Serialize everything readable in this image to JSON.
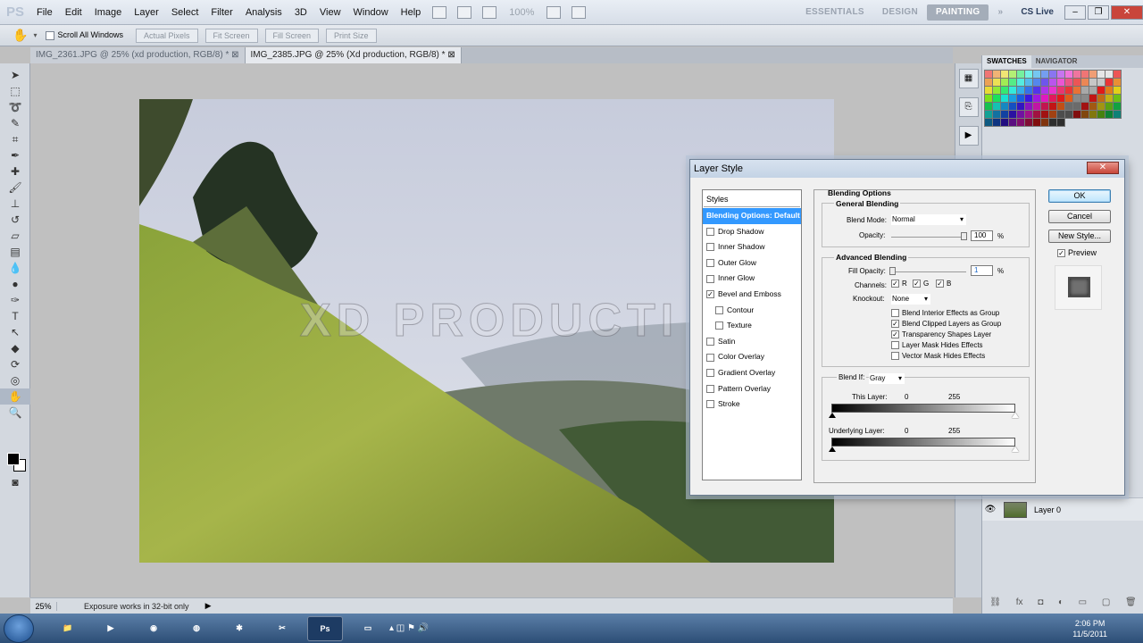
{
  "app": {
    "logo": "PS"
  },
  "menu": {
    "items": [
      "File",
      "Edit",
      "Image",
      "Layer",
      "Select",
      "Filter",
      "Analysis",
      "3D",
      "View",
      "Window",
      "Help"
    ]
  },
  "appbar": {
    "zoom": "100%"
  },
  "workspaces": {
    "items": [
      "ESSENTIALS",
      "DESIGN",
      "PAINTING"
    ],
    "active": "PAINTING",
    "more": "»"
  },
  "cslive": "CS Live",
  "options_bar": {
    "scroll_all": "Scroll All Windows",
    "buttons": [
      "Actual Pixels",
      "Fit Screen",
      "Fill Screen",
      "Print Size"
    ]
  },
  "doc_tabs": [
    {
      "label": "IMG_2361.JPG @ 25% (xd production, RGB/8) *"
    },
    {
      "label": "IMG_2385.JPG @ 25% (Xd production, RGB/8) *",
      "active": true
    }
  ],
  "canvas": {
    "watermark": "XD PRODUCTI"
  },
  "status": {
    "zoom": "25%",
    "text": "Exposure works in 32-bit only"
  },
  "right_panel": {
    "tabs": [
      "SWATCHES",
      "NAVIGATOR"
    ],
    "layer_name": "Layer 0"
  },
  "dialog": {
    "title": "Layer Style",
    "styles_header": "Styles",
    "styles": [
      {
        "label": "Blending Options: Default",
        "selected": true
      },
      {
        "label": "Drop Shadow",
        "checked": false
      },
      {
        "label": "Inner Shadow",
        "checked": false
      },
      {
        "label": "Outer Glow",
        "checked": false
      },
      {
        "label": "Inner Glow",
        "checked": false
      },
      {
        "label": "Bevel and Emboss",
        "checked": true
      },
      {
        "label": "Contour",
        "checked": false,
        "indent": true
      },
      {
        "label": "Texture",
        "checked": false,
        "indent": true
      },
      {
        "label": "Satin",
        "checked": false
      },
      {
        "label": "Color Overlay",
        "checked": false
      },
      {
        "label": "Gradient Overlay",
        "checked": false
      },
      {
        "label": "Pattern Overlay",
        "checked": false
      },
      {
        "label": "Stroke",
        "checked": false
      }
    ],
    "blending_options": "Blending Options",
    "general": {
      "title": "General Blending",
      "blend_mode_label": "Blend Mode:",
      "blend_mode": "Normal",
      "opacity_label": "Opacity:",
      "opacity": "100",
      "percent": "%"
    },
    "advanced": {
      "title": "Advanced Blending",
      "fill_opacity_label": "Fill Opacity:",
      "fill_opacity": "1",
      "percent": "%",
      "channels_label": "Channels:",
      "channels": [
        "R",
        "G",
        "B"
      ],
      "knockout_label": "Knockout:",
      "knockout": "None",
      "options": [
        {
          "label": "Blend Interior Effects as Group",
          "checked": false
        },
        {
          "label": "Blend Clipped Layers as Group",
          "checked": true
        },
        {
          "label": "Transparency Shapes Layer",
          "checked": true
        },
        {
          "label": "Layer Mask Hides Effects",
          "checked": false
        },
        {
          "label": "Vector Mask Hides Effects",
          "checked": false
        }
      ]
    },
    "blend_if": {
      "label": "Blend If:",
      "value": "Gray",
      "this_layer_label": "This Layer:",
      "this_layer_min": "0",
      "this_layer_max": "255",
      "underlying_label": "Underlying Layer:",
      "underlying_min": "0",
      "underlying_max": "255"
    },
    "buttons": {
      "ok": "OK",
      "cancel": "Cancel",
      "new_style": "New Style...",
      "preview": "Preview"
    }
  },
  "taskbar": {
    "time": "2:06 PM",
    "date": "11/5/2011",
    "ps_label": "Ps"
  }
}
